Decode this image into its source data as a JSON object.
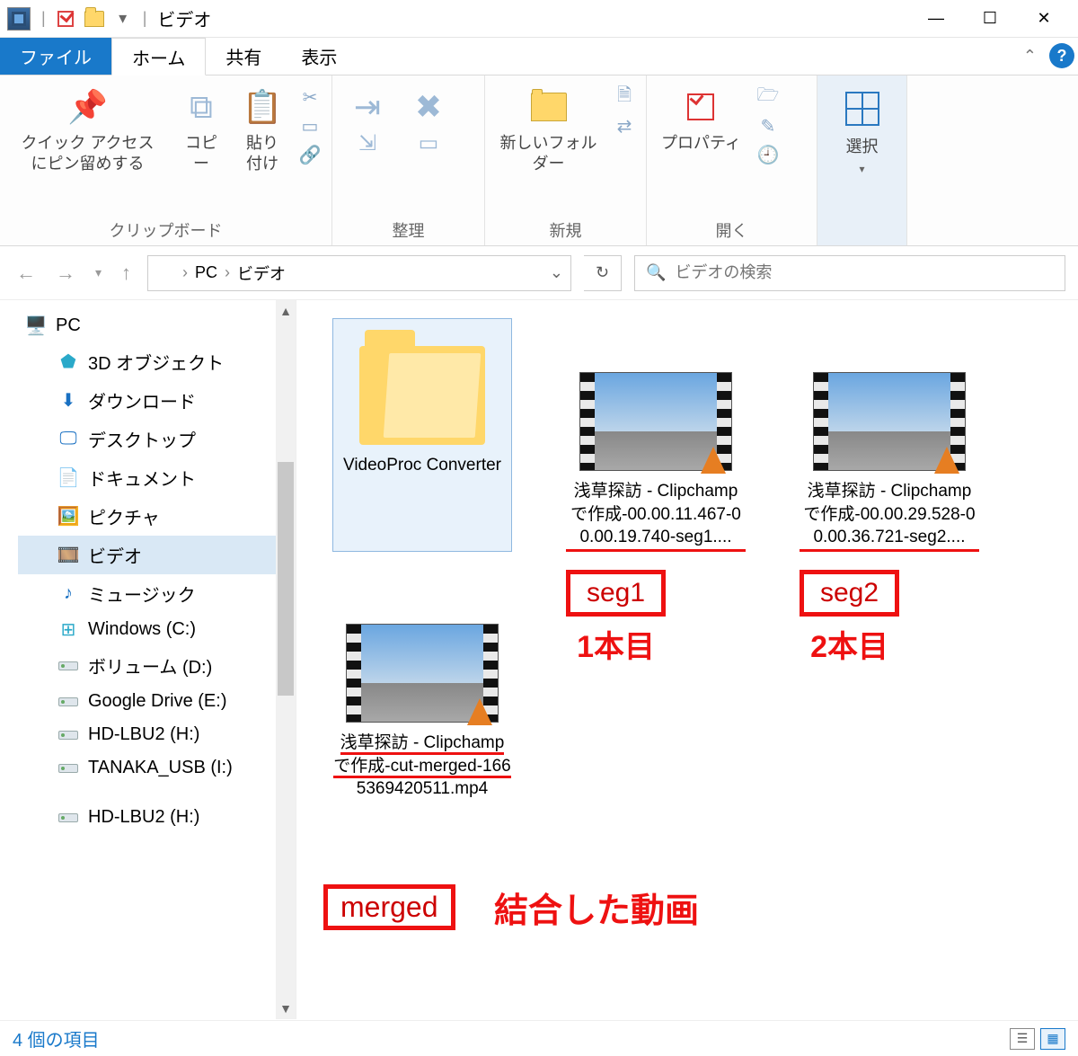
{
  "window": {
    "title": "ビデオ",
    "minimize": "—",
    "maximize": "☐",
    "close": "✕"
  },
  "ribbon": {
    "tabs": {
      "file": "ファイル",
      "home": "ホーム",
      "share": "共有",
      "view": "表示"
    },
    "groups": {
      "clipboard": {
        "label": "クリップボード",
        "pin": "クイック アクセスにピン留めする",
        "copy": "コピー",
        "paste": "貼り付け"
      },
      "organize": {
        "label": "整理"
      },
      "new": {
        "label": "新規",
        "newfolder": "新しいフォルダー"
      },
      "open": {
        "label": "開く",
        "properties": "プロパティ"
      },
      "select": {
        "label": "選択"
      }
    }
  },
  "nav": {
    "breadcrumb": [
      "PC",
      "ビデオ"
    ],
    "search_placeholder": "ビデオの検索"
  },
  "sidebar": {
    "items": [
      {
        "label": "PC"
      },
      {
        "label": "3D オブジェクト"
      },
      {
        "label": "ダウンロード"
      },
      {
        "label": "デスクトップ"
      },
      {
        "label": "ドキュメント"
      },
      {
        "label": "ピクチャ"
      },
      {
        "label": "ビデオ"
      },
      {
        "label": "ミュージック"
      },
      {
        "label": "Windows (C:)"
      },
      {
        "label": "ボリューム (D:)"
      },
      {
        "label": "Google Drive (E:)"
      },
      {
        "label": "HD-LBU2 (H:)"
      },
      {
        "label": "TANAKA_USB (I:)"
      },
      {
        "label": "HD-LBU2 (H:)"
      }
    ]
  },
  "files": {
    "folder1": "VideoProc Converter",
    "video1": "浅草探訪 - Clipchampで作成-00.00.11.467-00.00.19.740-seg1....",
    "video2": "浅草探訪 - Clipchampで作成-00.00.29.528-00.00.36.721-seg2....",
    "video3_a": "浅草探訪 - Clipchampで作成-cut-merged-166",
    "video3_b": "5369420511.mp4"
  },
  "annotations": {
    "seg1_box": "seg1",
    "seg1_txt": "1本目",
    "seg2_box": "seg2",
    "seg2_txt": "2本目",
    "merged_box": "merged",
    "merged_txt": "結合した動画"
  },
  "status": {
    "count": "4 個の項目"
  }
}
